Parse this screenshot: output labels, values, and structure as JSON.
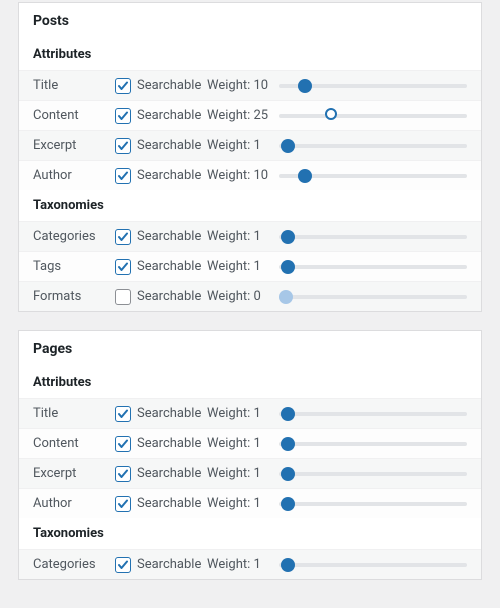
{
  "labels": {
    "searchable": "Searchable",
    "weight_prefix": "Weight: "
  },
  "slider": {
    "max": 100
  },
  "groups": [
    {
      "title": "Posts",
      "sections": [
        {
          "heading": "Attributes",
          "rows": [
            {
              "name": "Title",
              "checked": true,
              "weight": 10,
              "alt": true,
              "thumb": "solid"
            },
            {
              "name": "Content",
              "checked": true,
              "weight": 25,
              "alt": false,
              "thumb": "hollow"
            },
            {
              "name": "Excerpt",
              "checked": true,
              "weight": 1,
              "alt": true,
              "thumb": "solid"
            },
            {
              "name": "Author",
              "checked": true,
              "weight": 10,
              "alt": false,
              "thumb": "solid"
            }
          ]
        },
        {
          "heading": "Taxonomies",
          "rows": [
            {
              "name": "Categories",
              "checked": true,
              "weight": 1,
              "alt": true,
              "thumb": "solid"
            },
            {
              "name": "Tags",
              "checked": true,
              "weight": 1,
              "alt": false,
              "thumb": "solid"
            },
            {
              "name": "Formats",
              "checked": false,
              "weight": 0,
              "alt": true,
              "thumb": "muted"
            }
          ]
        }
      ]
    },
    {
      "title": "Pages",
      "sections": [
        {
          "heading": "Attributes",
          "rows": [
            {
              "name": "Title",
              "checked": true,
              "weight": 1,
              "alt": true,
              "thumb": "solid"
            },
            {
              "name": "Content",
              "checked": true,
              "weight": 1,
              "alt": false,
              "thumb": "solid"
            },
            {
              "name": "Excerpt",
              "checked": true,
              "weight": 1,
              "alt": true,
              "thumb": "solid"
            },
            {
              "name": "Author",
              "checked": true,
              "weight": 1,
              "alt": false,
              "thumb": "solid"
            }
          ]
        },
        {
          "heading": "Taxonomies",
          "rows": [
            {
              "name": "Categories",
              "checked": true,
              "weight": 1,
              "alt": true,
              "thumb": "solid"
            }
          ]
        }
      ]
    }
  ]
}
